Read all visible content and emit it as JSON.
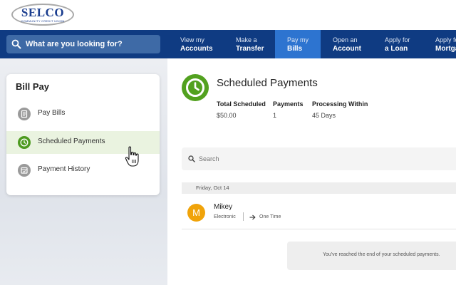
{
  "logo": {
    "name": "SELCO",
    "tagline": "COMMUNITY CREDIT UNION"
  },
  "search": {
    "placeholder": "What are you looking for?",
    "icon": "search-icon"
  },
  "nav": {
    "items": [
      {
        "line1": "View my",
        "line2": "Accounts"
      },
      {
        "line1": "Make a",
        "line2": "Transfer"
      },
      {
        "line1": "Pay my",
        "line2": "Bills"
      },
      {
        "line1": "Open an",
        "line2": "Account"
      },
      {
        "line1": "Apply for",
        "line2": "a Loan"
      },
      {
        "line1": "Apply for",
        "line2": "Mortgage"
      }
    ],
    "active": "Pay my Bills"
  },
  "sidebar": {
    "title": "Bill Pay",
    "items": [
      {
        "label": "Pay Bills",
        "icon": "document-icon"
      },
      {
        "label": "Scheduled Payments",
        "icon": "clock-icon"
      },
      {
        "label": "Payment History",
        "icon": "calendar-icon"
      }
    ],
    "active": "Scheduled Payments"
  },
  "main": {
    "title": "Scheduled Payments",
    "icon": "clock-icon",
    "stats": [
      {
        "label": "Total Scheduled",
        "value": "$50.00"
      },
      {
        "label": "Payments",
        "value": "1"
      },
      {
        "label": "Processing Within",
        "value": "45 Days"
      }
    ],
    "search_placeholder": "Search",
    "groups": [
      {
        "date": "Friday, Oct 14",
        "payments": [
          {
            "initial": "M",
            "name": "Mikey",
            "method": "Electronic",
            "frequency": "One Time"
          }
        ]
      }
    ],
    "end_message": "You've reached the end of your scheduled payments."
  },
  "colors": {
    "nav_bg": "#0f3b82",
    "nav_active": "#2d74d0",
    "accent_green": "#52a11f",
    "avatar_orange": "#f0a30a",
    "brand_blue": "#1a3d8f"
  }
}
